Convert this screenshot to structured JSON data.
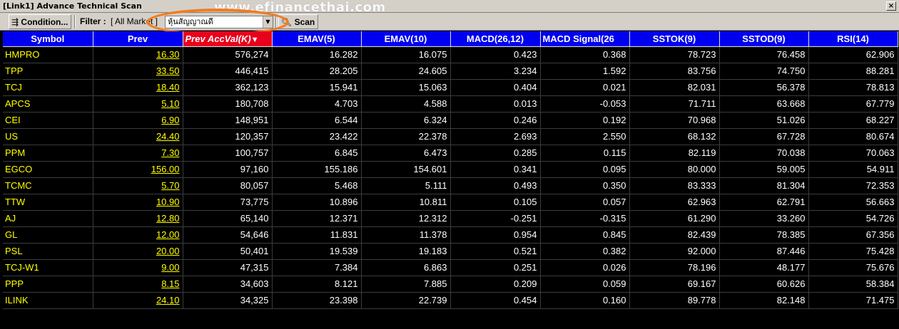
{
  "window": {
    "title": "[Link1] Advance Technical Scan",
    "watermark": "www.efinancethai.com"
  },
  "toolbar": {
    "condition_label": "Condition...",
    "filter_label": "Filter :",
    "filter_value": "[ All Market ]",
    "combo_value": "หุ้นสัญญาณดี",
    "scan_label": "Scan"
  },
  "colors": {
    "header_bg": "#0000f0",
    "sorted_header_bg": "#e8001c",
    "symbol_text": "#ffff00",
    "highlight_ring": "#f27c1f"
  },
  "table": {
    "columns": [
      "Symbol",
      "Prev",
      "Prev AccVal(K)",
      "EMAV(5)",
      "EMAV(10)",
      "MACD(26,12)",
      "MACD Signal(26",
      "SSTOK(9)",
      "SSTOD(9)",
      "RSI(14)"
    ],
    "sorted_column": "Prev AccVal(K)",
    "rows": [
      [
        "HMPRO",
        "16.30",
        "576,274",
        "16.282",
        "16.075",
        "0.423",
        "0.368",
        "78.723",
        "76.458",
        "62.906"
      ],
      [
        "TPP",
        "33.50",
        "446,415",
        "28.205",
        "24.605",
        "3.234",
        "1.592",
        "83.756",
        "74.750",
        "88.281"
      ],
      [
        "TCJ",
        "18.40",
        "362,123",
        "15.941",
        "15.063",
        "0.404",
        "0.021",
        "82.031",
        "56.378",
        "78.813"
      ],
      [
        "APCS",
        "5.10",
        "180,708",
        "4.703",
        "4.588",
        "0.013",
        "-0.053",
        "71.711",
        "63.668",
        "67.779"
      ],
      [
        "CEI",
        "6.90",
        "148,951",
        "6.544",
        "6.324",
        "0.246",
        "0.192",
        "70.968",
        "51.026",
        "68.227"
      ],
      [
        "US",
        "24.40",
        "120,357",
        "23.422",
        "22.378",
        "2.693",
        "2.550",
        "68.132",
        "67.728",
        "80.674"
      ],
      [
        "PPM",
        "7.30",
        "100,757",
        "6.845",
        "6.473",
        "0.285",
        "0.115",
        "82.119",
        "70.038",
        "70.063"
      ],
      [
        "EGCO",
        "156.00",
        "97,160",
        "155.186",
        "154.601",
        "0.341",
        "0.095",
        "80.000",
        "59.005",
        "54.911"
      ],
      [
        "TCMC",
        "5.70",
        "80,057",
        "5.468",
        "5.111",
        "0.493",
        "0.350",
        "83.333",
        "81.304",
        "72.353"
      ],
      [
        "TTW",
        "10.90",
        "73,775",
        "10.896",
        "10.811",
        "0.105",
        "0.057",
        "62.963",
        "62.791",
        "56.663"
      ],
      [
        "AJ",
        "12.80",
        "65,140",
        "12.371",
        "12.312",
        "-0.251",
        "-0.315",
        "61.290",
        "33.260",
        "54.726"
      ],
      [
        "GL",
        "12.00",
        "54,646",
        "11.831",
        "11.378",
        "0.954",
        "0.845",
        "82.439",
        "78.385",
        "67.356"
      ],
      [
        "PSL",
        "20.00",
        "50,401",
        "19.539",
        "19.183",
        "0.521",
        "0.382",
        "92.000",
        "87.446",
        "75.428"
      ],
      [
        "TCJ-W1",
        "9.00",
        "47,315",
        "7.384",
        "6.863",
        "0.251",
        "0.026",
        "78.196",
        "48.177",
        "75.676"
      ],
      [
        "PPP",
        "8.15",
        "34,603",
        "8.121",
        "7.885",
        "0.209",
        "0.059",
        "69.167",
        "60.626",
        "58.384"
      ],
      [
        "ILINK",
        "24.10",
        "34,325",
        "23.398",
        "22.739",
        "0.454",
        "0.160",
        "89.778",
        "82.148",
        "71.475"
      ]
    ]
  }
}
